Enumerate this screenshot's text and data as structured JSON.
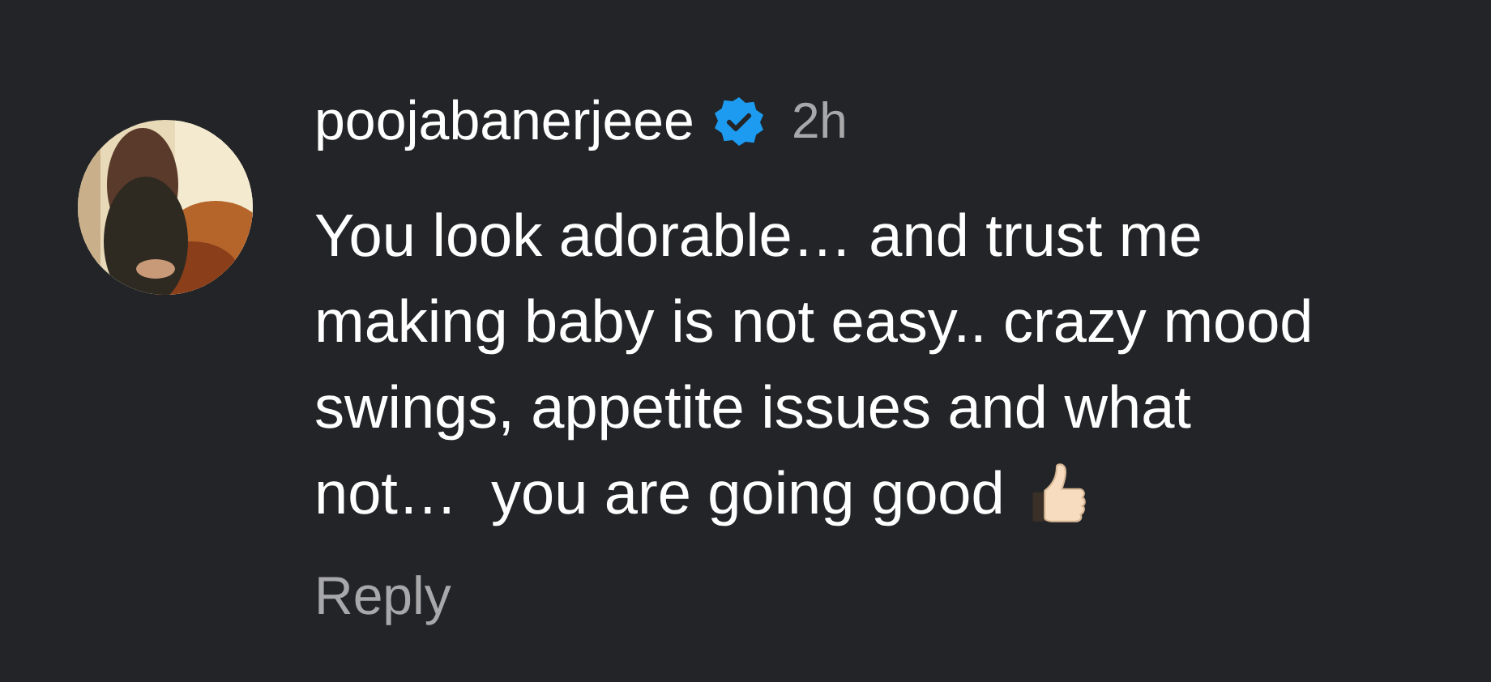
{
  "comment": {
    "username": "poojabanerjeee",
    "verified": true,
    "time": "2h",
    "lines": [
      "You look adorable… and trust me",
      "making baby is not easy.. crazy mood",
      "swings, appetite issues and what",
      "not…  you are going good"
    ],
    "reply": "Reply"
  }
}
